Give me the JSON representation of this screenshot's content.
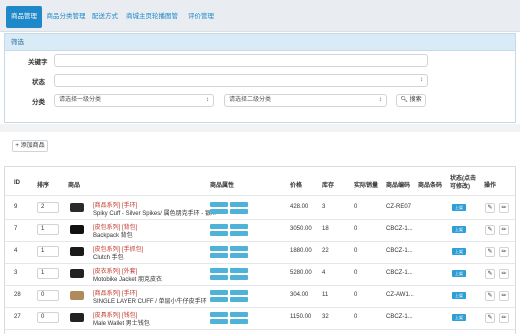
{
  "tabs": [
    {
      "label": "商品管理"
    },
    {
      "label": "商品分类管理"
    },
    {
      "label": "配送方式"
    },
    {
      "label": "商城主页轮播图管理"
    },
    {
      "label": "评价管理"
    }
  ],
  "filter": {
    "title": "筛选",
    "keyword_label": "关键字",
    "status_label": "状态",
    "category_label": "分类",
    "category1_placeholder": "请选择一级分类",
    "category2_placeholder": "请选择二级分类",
    "search_label": "搜索"
  },
  "add_button": "添加商品",
  "table": {
    "headers": {
      "id": "ID",
      "sort": "排序",
      "image": "商品",
      "attr": "商品属性",
      "price": "价格",
      "stock": "库存",
      "sales": "实际销量",
      "code": "商品编码",
      "barcode": "商品条码",
      "status": "状态(点击可修改)",
      "actions": "操作"
    },
    "status_badge": "上架",
    "rows": [
      {
        "id": "9",
        "sort": "2",
        "category": "[商品系列] [手环]",
        "name": "Spiky Cuff - Silver Spikes/ 属色朋克手环 - 银...",
        "price": "428.00",
        "stock": "3",
        "sales": "0",
        "code": "CZ-RE07",
        "thumb_color": "#2b2b2b"
      },
      {
        "id": "7",
        "sort": "1",
        "category": "[皮包系列] [背包]",
        "name": "Backpack 背包",
        "price": "3050.00",
        "stock": "18",
        "sales": "0",
        "code": "CBCZ-1...",
        "thumb_color": "#111111"
      },
      {
        "id": "4",
        "sort": "1",
        "category": "[皮包系列] [手抓包]",
        "name": "Clutch 手包",
        "price": "1880.00",
        "stock": "22",
        "sales": "0",
        "code": "CBCZ-1...",
        "thumb_color": "#1a1a1a"
      },
      {
        "id": "3",
        "sort": "1",
        "category": "[皮衣系列] [外套]",
        "name": "Motobike Jacket 朋克皮衣",
        "price": "5280.00",
        "stock": "4",
        "sales": "0",
        "code": "CBCZ-1...",
        "thumb_color": "#222222"
      },
      {
        "id": "28",
        "sort": "0",
        "category": "[商品系列] [手环]",
        "name": "SINGLE LAYER CUFF / 单层小牛仔皮手环",
        "price": "304.00",
        "stock": "11",
        "sales": "0",
        "code": "CZ-AW1...",
        "thumb_color": "#b08a5a"
      },
      {
        "id": "27",
        "sort": "0",
        "category": "[皮具系列] [钱包]",
        "name": "Male Wallet 男士钱包",
        "price": "1150.00",
        "stock": "32",
        "sales": "0",
        "code": "CBCZ-1...",
        "thumb_color": "#222222"
      }
    ]
  }
}
